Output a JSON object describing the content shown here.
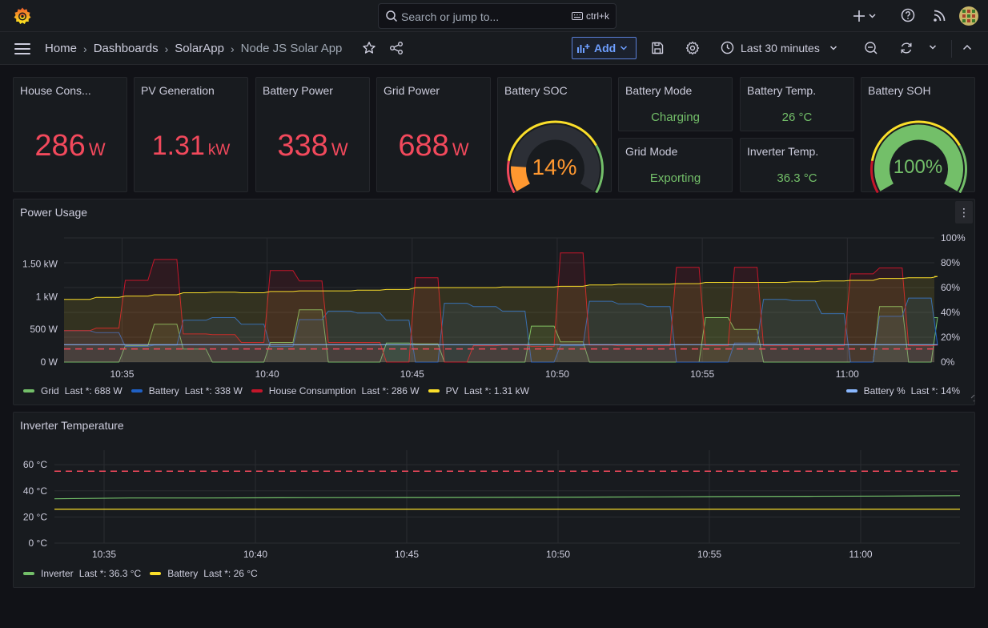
{
  "topbar": {
    "search_placeholder": "Search or jump to...",
    "search_shortcut": "ctrl+k"
  },
  "breadcrumb": {
    "home": "Home",
    "dashboards": "Dashboards",
    "folder": "SolarApp",
    "current": "Node JS Solar App"
  },
  "toolbar": {
    "add_label": "Add",
    "time_range": "Last 30 minutes"
  },
  "stats": {
    "house": {
      "title": "House Cons...",
      "value": "286",
      "unit": "W"
    },
    "pv": {
      "title": "PV Generation",
      "value": "1.31",
      "unit": "kW"
    },
    "battery_power": {
      "title": "Battery Power",
      "value": "338",
      "unit": "W"
    },
    "grid_power": {
      "title": "Grid Power",
      "value": "688",
      "unit": "W"
    },
    "battery_soc": {
      "title": "Battery SOC",
      "value": "14%",
      "level": 0.14
    },
    "battery_mode": {
      "title": "Battery Mode",
      "value": "Charging"
    },
    "battery_temp": {
      "title": "Battery Temp.",
      "value": "26 °C"
    },
    "grid_mode": {
      "title": "Grid Mode",
      "value": "Exporting"
    },
    "inverter_temp": {
      "title": "Inverter Temp.",
      "value": "36.3 °C"
    },
    "battery_soh": {
      "title": "Battery SOH",
      "value": "100%",
      "level": 1.0
    }
  },
  "colors": {
    "red": "#f2495c",
    "green": "#73bf69",
    "orange": "#ff9830",
    "yellow": "#fade2a",
    "blue": "#5794f2",
    "lightblue": "#8ab8ff",
    "darkred": "#c4162a"
  },
  "power_usage": {
    "title": "Power Usage",
    "legend": [
      {
        "name": "Grid",
        "last": "Last *: 688 W",
        "color": "#73bf69"
      },
      {
        "name": "Battery",
        "last": "Last *: 338 W",
        "color": "#1f60c4"
      },
      {
        "name": "House Consumption",
        "last": "Last *: 286 W",
        "color": "#c4162a"
      },
      {
        "name": "PV",
        "last": "Last *: 1.31 kW",
        "color": "#fade2a"
      }
    ],
    "legend_right": {
      "name": "Battery %",
      "last": "Last *: 14%",
      "color": "#8ab8ff"
    }
  },
  "inverter_temperature": {
    "title": "Inverter Temperature",
    "legend": [
      {
        "name": "Inverter",
        "last": "Last *: 36.3 °C",
        "color": "#73bf69"
      },
      {
        "name": "Battery",
        "last": "Last *: 26 °C",
        "color": "#fade2a"
      }
    ]
  },
  "chart_data": [
    {
      "type": "area",
      "title": "Power Usage",
      "x": [
        "10:33",
        "10:34",
        "10:35",
        "10:36",
        "10:37",
        "10:38",
        "10:39",
        "10:40",
        "10:41",
        "10:42",
        "10:43",
        "10:44",
        "10:45",
        "10:46",
        "10:47",
        "10:48",
        "10:49",
        "10:50",
        "10:51",
        "10:52",
        "10:53",
        "10:54",
        "10:55",
        "10:56",
        "10:57",
        "10:58",
        "10:59",
        "11:00",
        "11:01",
        "11:02",
        "11:03"
      ],
      "x_ticks": [
        "10:35",
        "10:40",
        "10:45",
        "10:50",
        "10:55",
        "11:00"
      ],
      "y_ticks_left": [
        "0 W",
        "500 W",
        "1 kW",
        "1.50 kW"
      ],
      "y_ticks_right": [
        "0%",
        "20%",
        "40%",
        "60%",
        "80%",
        "100%"
      ],
      "ylim_left_w": [
        0,
        1900
      ],
      "ylim_right_pct": [
        0,
        100
      ],
      "threshold_w": 200,
      "series": [
        {
          "name": "Grid",
          "axis": "left",
          "values": [
            0,
            0,
            250,
            580,
            200,
            0,
            0,
            300,
            800,
            0,
            0,
            290,
            280,
            0,
            0,
            0,
            550,
            310,
            0,
            0,
            0,
            0,
            680,
            500,
            0,
            0,
            0,
            0,
            850,
            0,
            680
          ]
        },
        {
          "name": "Battery",
          "axis": "left",
          "values": [
            480,
            450,
            240,
            260,
            640,
            680,
            580,
            240,
            650,
            780,
            750,
            640,
            0,
            900,
            850,
            780,
            0,
            250,
            930,
            890,
            850,
            0,
            0,
            290,
            960,
            940,
            740,
            0,
            700,
            980,
            260
          ]
        },
        {
          "name": "House Consumption",
          "axis": "left",
          "values": [
            480,
            520,
            1250,
            1570,
            430,
            420,
            300,
            1400,
            1240,
            300,
            300,
            0,
            1290,
            0,
            250,
            260,
            240,
            1670,
            260,
            250,
            250,
            1450,
            250,
            1450,
            250,
            250,
            250,
            1350,
            1440,
            250,
            260
          ]
        },
        {
          "name": "PV",
          "axis": "left",
          "values": [
            960,
            990,
            1010,
            1030,
            1060,
            1070,
            1060,
            1080,
            1090,
            1090,
            1100,
            1110,
            1140,
            1140,
            1140,
            1150,
            1150,
            1160,
            1180,
            1190,
            1190,
            1200,
            1220,
            1220,
            1220,
            1230,
            1240,
            1250,
            1280,
            1290,
            1310
          ]
        },
        {
          "name": "Battery %",
          "axis": "right",
          "values": [
            14,
            14,
            14,
            14,
            14,
            14,
            14,
            14,
            14,
            14,
            14,
            14,
            14,
            14,
            14,
            14,
            14,
            14,
            14,
            14,
            14,
            14,
            14,
            14,
            14,
            14,
            14,
            14,
            14,
            14,
            14
          ]
        }
      ]
    },
    {
      "type": "line",
      "title": "Inverter Temperature",
      "x_ticks": [
        "10:35",
        "10:40",
        "10:45",
        "10:50",
        "10:55",
        "11:00"
      ],
      "y_ticks": [
        "0 °C",
        "20 °C",
        "40 °C",
        "60 °C"
      ],
      "ylim": [
        0,
        60
      ],
      "threshold": 55,
      "series": [
        {
          "name": "Inverter",
          "values": [
            33.9,
            34.5,
            34.5,
            34.7,
            34.8,
            34.9,
            35.0,
            35.2,
            35.4,
            35.6,
            35.8,
            36.0,
            36.3
          ]
        },
        {
          "name": "Battery",
          "values": [
            26,
            26,
            26,
            26,
            26,
            26,
            26,
            26,
            26,
            26,
            26,
            26,
            26
          ]
        }
      ]
    }
  ]
}
